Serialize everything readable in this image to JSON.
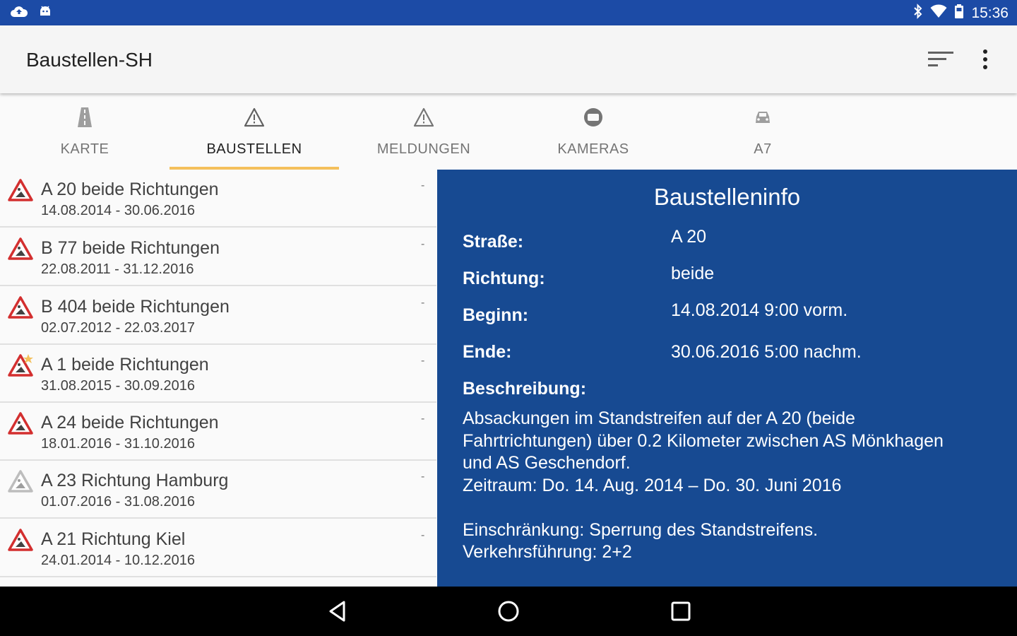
{
  "status_bar": {
    "time": "15:36",
    "left_icons": [
      "cloud-upload-icon",
      "android-icon"
    ],
    "right_icons": [
      "bluetooth-icon",
      "wifi-icon",
      "battery-icon"
    ],
    "color": "#1c4ba6"
  },
  "app_bar": {
    "title": "Baustellen-SH",
    "actions": [
      "sort-icon",
      "more-vert-icon"
    ]
  },
  "tabs": [
    {
      "label": "KARTE",
      "icon": "road-icon",
      "active": false
    },
    {
      "label": "BAUSTELLEN",
      "icon": "warning-triangle-icon",
      "active": true
    },
    {
      "label": "MELDUNGEN",
      "icon": "warning-triangle-icon",
      "active": false
    },
    {
      "label": "KAMERAS",
      "icon": "camera-icon",
      "active": false
    },
    {
      "label": "A7",
      "icon": "car-icon",
      "active": false
    }
  ],
  "accent_color": "#f4c05c",
  "list": {
    "items": [
      {
        "title": "A 20 beide Richtungen",
        "dates": "14.08.2014 - 30.06.2016",
        "trailing": "-",
        "icon": "roadwork-sign-icon"
      },
      {
        "title": "B 77 beide Richtungen",
        "dates": "22.08.2011 - 31.12.2016",
        "trailing": "-",
        "icon": "roadwork-sign-icon"
      },
      {
        "title": "B 404 beide Richtungen",
        "dates": "02.07.2012 - 22.03.2017",
        "trailing": "-",
        "icon": "roadwork-sign-icon"
      },
      {
        "title": "A 1 beide Richtungen",
        "dates": "31.08.2015 - 30.09.2016",
        "trailing": "-",
        "icon": "roadwork-sign-new-icon"
      },
      {
        "title": "A 24 beide Richtungen",
        "dates": "18.01.2016 - 31.10.2016",
        "trailing": "-",
        "icon": "roadwork-sign-icon"
      },
      {
        "title": "A 23 Richtung Hamburg",
        "dates": "01.07.2016 - 31.08.2016",
        "trailing": "-",
        "icon": "roadwork-sign-gray-icon"
      },
      {
        "title": "A 21 Richtung Kiel",
        "dates": "24.01.2014 - 10.12.2016",
        "trailing": "-",
        "icon": "roadwork-sign-icon"
      }
    ]
  },
  "detail": {
    "title": "Baustelleninfo",
    "background": "#174a92",
    "fields": [
      {
        "label": "Straße:",
        "value": "A 20"
      },
      {
        "label": "Richtung:",
        "value": "beide"
      },
      {
        "label": "Beginn:",
        "value": "14.08.2014 9:00 vorm."
      },
      {
        "label": "Ende:",
        "value": "30.06.2016 5:00 nachm."
      }
    ],
    "description_label": "Beschreibung:",
    "description": "Absackungen im Standstreifen auf der A 20 (beide\nFahrtrichtungen) über 0.2 Kilometer zwischen AS Mönkhagen\nund AS Geschendorf.\nZeitraum: Do. 14. Aug. 2014 – Do. 30. Juni 2016\n\nEinschränkung: Sperrung des Standstreifens.\nVerkehrsführung: 2+2"
  },
  "nav_bar": {
    "buttons": [
      "back-icon",
      "home-icon",
      "recents-icon"
    ]
  }
}
